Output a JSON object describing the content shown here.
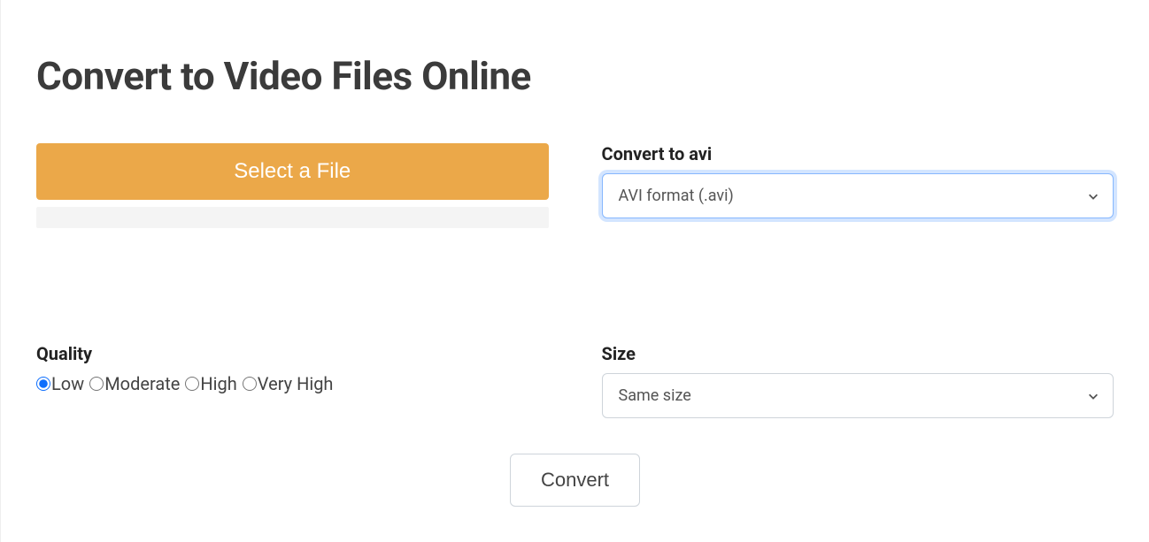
{
  "page": {
    "title": "Convert to Video Files Online"
  },
  "upload": {
    "select_file_label": "Select a File"
  },
  "format": {
    "label": "Convert to avi",
    "selected": "AVI format (.avi)"
  },
  "quality": {
    "label": "Quality",
    "options": {
      "low": "Low",
      "moderate": "Moderate",
      "high": "High",
      "very_high": "Very High"
    },
    "selected": "low"
  },
  "size": {
    "label": "Size",
    "selected": "Same size"
  },
  "actions": {
    "convert_label": "Convert"
  }
}
